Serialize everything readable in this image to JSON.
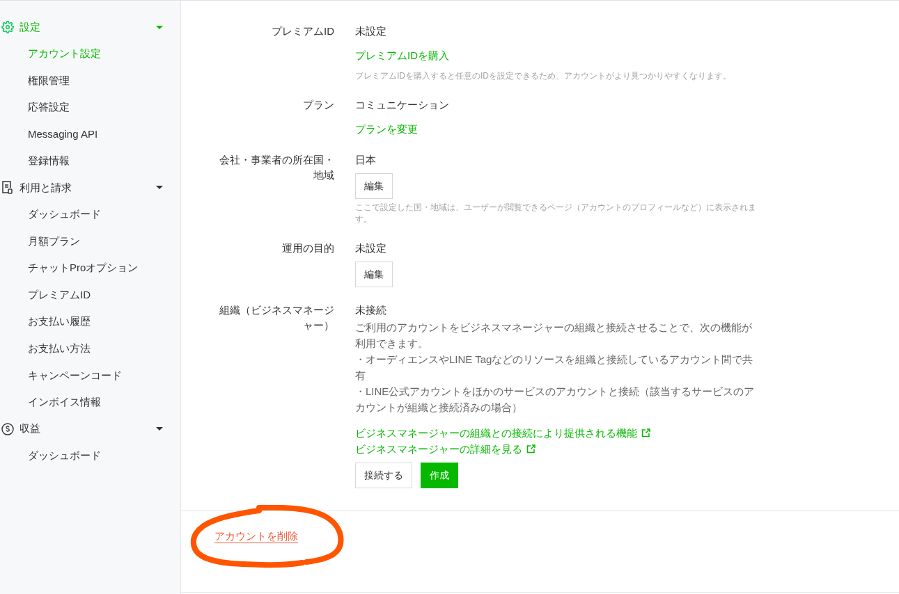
{
  "sidebar": {
    "sections": [
      {
        "kind": "settings",
        "title": "設定",
        "expanded": true,
        "items": [
          {
            "label": "アカウント設定",
            "selected": true
          },
          {
            "label": "権限管理",
            "selected": false
          },
          {
            "label": "応答設定",
            "selected": false
          },
          {
            "label": "Messaging API",
            "selected": false
          },
          {
            "label": "登録情報",
            "selected": false
          }
        ]
      },
      {
        "kind": "billing",
        "title": "利用と請求",
        "expanded": true,
        "items": [
          {
            "label": "ダッシュボード",
            "selected": false
          },
          {
            "label": "月額プラン",
            "selected": false
          },
          {
            "label": "チャットProオプション",
            "selected": false
          },
          {
            "label": "プレミアムID",
            "selected": false
          },
          {
            "label": "お支払い履歴",
            "selected": false
          },
          {
            "label": "お支払い方法",
            "selected": false
          },
          {
            "label": "キャンペーンコード",
            "selected": false
          },
          {
            "label": "インボイス情報",
            "selected": false
          }
        ]
      },
      {
        "kind": "revenue",
        "title": "収益",
        "expanded": true,
        "items": [
          {
            "label": "ダッシュボード",
            "selected": false
          }
        ]
      }
    ]
  },
  "settings": [
    {
      "label": "プレミアムID",
      "value": "未設定",
      "links": [
        {
          "text": "プレミアムIDを購入",
          "external": false
        }
      ],
      "note": "プレミアムIDを購入すると任意のIDを設定できるため、アカウントがより見つかりやすくなります。"
    },
    {
      "label": "プラン",
      "value": "コミュニケーション",
      "links": [
        {
          "text": "プランを変更",
          "external": false
        }
      ]
    },
    {
      "label": "会社・事業者の所在国・地域",
      "value": "日本",
      "buttons": [
        {
          "label": "編集",
          "primary": false
        }
      ],
      "note": "ここで設定した国・地域は、ユーザーが閲覧できるページ（アカウントのプロフィールなど）に表示されます。"
    },
    {
      "label": "運用の目的",
      "value": "未設定",
      "buttons": [
        {
          "label": "編集",
          "primary": false
        }
      ]
    },
    {
      "label": "組織（ビジネスマネージャー）",
      "value": "未接続",
      "description": [
        "ご利用のアカウントをビジネスマネージャーの組織と接続させることで、次の機能が利用できます。",
        "・オーディエンスやLINE Tagなどのリソースを組織と接続しているアカウント間で共有",
        "・LINE公式アカウントをほかのサービスのアカウントと接続（該当するサービスのアカウントが組織と接続済みの場合）"
      ],
      "links": [
        {
          "text": "ビジネスマネージャーの組織との接続により提供される機能",
          "external": true
        },
        {
          "text": "ビジネスマネージャーの詳細を見る",
          "external": true
        }
      ],
      "buttons": [
        {
          "label": "接続する",
          "primary": false
        },
        {
          "label": "作成",
          "primary": true
        }
      ]
    }
  ],
  "delete_link": "アカウントを削除"
}
